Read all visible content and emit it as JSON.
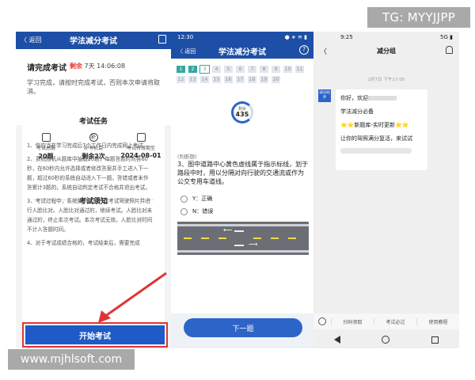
{
  "watermark_top": "TG: MYYJJPP",
  "watermark_bottom": "www.mjhlsoft.com",
  "panel1": {
    "back": "〈 返回",
    "title": "学法减分考试",
    "card_heading": "请完成考试",
    "remaining_label": "剩余",
    "remaining_value": "7天 14:06:08",
    "card_desc": "学习完成，请按时完成考试，否则本次申请将取消。",
    "task_title": "考试任务",
    "stats": [
      {
        "label": "考试总数",
        "value": "20题"
      },
      {
        "label": "补考机会",
        "value": "剩余2次"
      },
      {
        "label": "考试有效期至",
        "value": "2024-08-01"
      }
    ],
    "notice_title": "考试须知",
    "rules": [
      "1、你应当在学习完成后7个工作日内完成网上考试。",
      "2、系统随机从题库中抽取20题，每题答题时间各60秒，在60秒内允许选择或者修改答案并手工进入下一题，超过60秒的系统自动进入下一题。答错或者未作答累计3题的，系统自动判定考试不合格并退出考试。",
      "3、考试过程中，系统随机抓拍一次考试驾驶照片并进行人脸比对。人脸比对通过的，继续考试。人脸比对未通过的，终止本次考试。本次考试无效。人脸比对时间不计入答题时间。",
      "4、对于考试成绩合格的，考试结束后，需要完成"
    ],
    "start_button": "开始考试"
  },
  "panel2": {
    "time": "12:30",
    "status_icons": "● ∗ ≋ ▮",
    "back": "〈 返回",
    "title": "学法减分考试",
    "help": "?",
    "question_numbers": [
      "1",
      "2",
      "3",
      "4",
      "5",
      "6",
      "7",
      "8",
      "9",
      "10",
      "11",
      "12",
      "13",
      "14",
      "15",
      "16",
      "17",
      "18",
      "19",
      "20"
    ],
    "timer_label": "剩余",
    "timer_value": "43S",
    "question_type": "(判断题)",
    "question_text": "3、图中道路中心黄色虚线属于指示标线，划于路段中时，用以分隔对向行驶的交通流或作为公交专用车道线。",
    "option_y": "Y：正确",
    "option_n": "N：错误",
    "next_button": "下一题"
  },
  "panel3": {
    "time": "9:25",
    "status_icons": "5G ▮",
    "back": "〈",
    "title": "减分组",
    "date": "2月7日 下午17:00",
    "avatar_text": "减分助手",
    "msg_greeting": "你好，欢迎",
    "msg_line2": "学法减分必备",
    "msg_line3": "⭐⭐新题库-实时更新⭐⭐",
    "msg_line4": "让你的驾照满分复活，来试试",
    "bottom_menu": [
      "扫码领取",
      "考试必过",
      "使用教程"
    ]
  },
  "colors": {
    "primary_blue": "#1e4fa6",
    "button_blue": "#2d64c8",
    "teal_done": "#37a6a0",
    "highlight_red": "#e03434",
    "remaining_red": "#e23b3b"
  }
}
